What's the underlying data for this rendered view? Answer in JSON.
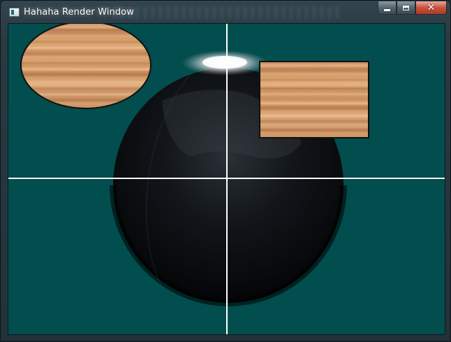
{
  "window": {
    "title": "Hahaha Render Window",
    "background_color": "#024d4d"
  },
  "controls": {
    "minimize_icon": "minimize-icon",
    "maximize_icon": "maximize-icon",
    "close_icon": "close-icon",
    "close_glyph": "✕"
  },
  "scene": {
    "objects": [
      "globe",
      "wood-textured-ellipse",
      "wood-textured-rectangle",
      "crosshair"
    ]
  }
}
